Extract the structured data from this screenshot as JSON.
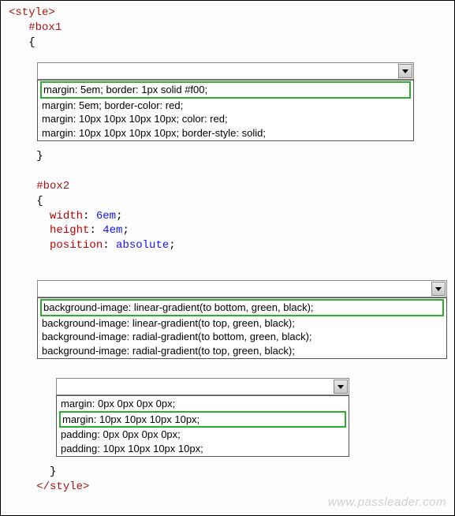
{
  "watermark": "www.passleader.com",
  "code": {
    "open_tag": "<style>",
    "close_tag": "</style>",
    "box1_selector": "#box1",
    "box2_selector": "#box2",
    "brace_open": "{",
    "brace_close": "}",
    "width_prop": "width",
    "width_val": "6em",
    "height_prop": "height",
    "height_val": "4em",
    "position_prop": "position",
    "position_val": "absolute",
    "colon": ": ",
    "semi": ";"
  },
  "dropdown1": {
    "options": [
      "margin: 5em; border: 1px solid #f00;",
      "margin: 5em; border-color: red;",
      "margin: 10px 10px 10px 10px; color: red;",
      "margin: 10px 10px 10px 10px; border-style: solid;"
    ],
    "selected_index": 0
  },
  "dropdown2": {
    "options": [
      "background-image: linear-gradient(to bottom, green, black);",
      "background-image: linear-gradient(to top, green, black);",
      "background-image: radial-gradient(to bottom, green, black);",
      "background-image: radial-gradient(to top, green, black);"
    ],
    "selected_index": 0
  },
  "dropdown3": {
    "options": [
      "margin: 0px 0px 0px 0px;",
      "margin: 10px 10px 10px 10px;",
      "padding: 0px 0px 0px 0px;",
      "padding: 10px 10px 10px 10px;"
    ],
    "selected_index": 1
  }
}
